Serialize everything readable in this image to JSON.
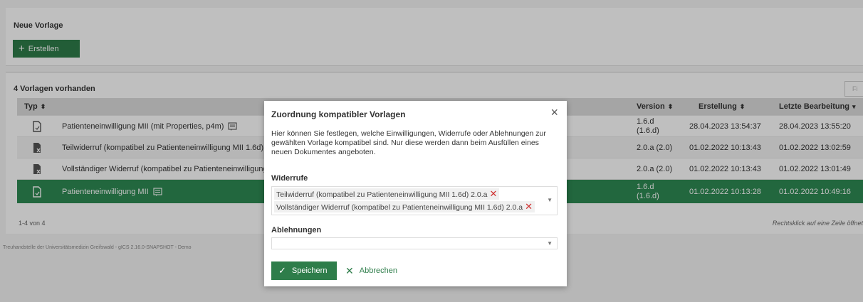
{
  "new_template": {
    "title": "Neue Vorlage",
    "create_label": "Erstellen",
    "create_icon": "+"
  },
  "list": {
    "title": "4 Vorlagen vorhanden",
    "filter_placeholder": "Fi",
    "columns": {
      "type": "Typ",
      "version": "Version",
      "created": "Erstellung",
      "edited": "Letzte Bearbeitung"
    },
    "rows": [
      {
        "name": "Patienteneinwilligung MII (mit Properties, p4m)",
        "has_comment": true,
        "icon": "consent-doc-icon",
        "version": "1.6.d",
        "version_sub": "(1.6.d)",
        "created": "28.04.2023 13:54:37",
        "edited": "28.04.2023 13:55:20"
      },
      {
        "name": "Teilwiderruf (kompatibel zu Patienteneinwilligung MII 1.6d)",
        "has_comment": false,
        "icon": "revocation-doc-icon",
        "version": "2.0.a (2.0)",
        "version_sub": "",
        "created": "01.02.2022 10:13:43",
        "edited": "01.02.2022 13:02:59"
      },
      {
        "name": "Vollständiger Widerruf (kompatibel zu Patienteneinwilligung",
        "has_comment": false,
        "icon": "revocation-doc-icon",
        "version": "2.0.a (2.0)",
        "version_sub": "",
        "created": "01.02.2022 10:13:43",
        "edited": "01.02.2022 13:01:49"
      },
      {
        "name": "Patienteneinwilligung MII",
        "has_comment": true,
        "icon": "consent-doc-icon",
        "version": "1.6.d",
        "version_sub": "(1.6.d)",
        "created": "01.02.2022 10:13:28",
        "edited": "01.02.2022 10:49:16"
      }
    ],
    "footer_count": "1-4 von 4",
    "footer_hint": "Rechtsklick auf eine Zeile öffnet"
  },
  "page_footer": "Treuhandstelle der Universitätsmedizin Greifswald - gICS 2.16.0-SNAPSHOT - Demo",
  "modal": {
    "title": "Zuordnung kompatibler Vorlagen",
    "close_icon": "×",
    "description": "Hier können Sie festlegen, welche Einwilligungen, Widerrufe oder Ablehnungen zur gewählten Vorlage kompatibel sind. Nur diese werden dann beim Ausfüllen eines neuen Dokumentes angeboten.",
    "revocations_label": "Widerrufe",
    "revocations_selected": [
      "Teilwiderruf (kompatibel zu Patienteneinwilligung MII 1.6d) 2.0.a",
      "Vollständiger Widerruf (kompatibel zu Patienteneinwilligung MII 1.6d) 2.0.a"
    ],
    "refusals_label": "Ablehnungen",
    "refusals_value": "",
    "save_label": "Speichern",
    "cancel_label": "Abbrechen"
  },
  "colors": {
    "primary_green": "#2e7d4a",
    "selected_row": "#2e8a53",
    "remove_red": "#d03030"
  }
}
